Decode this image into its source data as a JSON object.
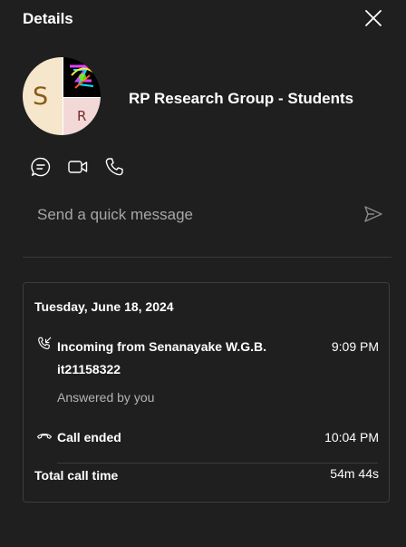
{
  "panel": {
    "title": "Details"
  },
  "group": {
    "name": "RP Research Group - Students",
    "avatar": {
      "left_letter": "S",
      "bottom_right_letter": "R"
    }
  },
  "actions": [
    {
      "icon": "chat-icon"
    },
    {
      "icon": "video-icon"
    },
    {
      "icon": "phone-icon"
    }
  ],
  "quick_message": {
    "placeholder": "Send a quick message",
    "value": ""
  },
  "call_log": {
    "date": "Tuesday, June 18, 2024",
    "incoming": {
      "line1": "Incoming from Senanayake W.G.B.",
      "line2": "it21158322",
      "time": "9:09 PM",
      "status": "Answered by you"
    },
    "ended": {
      "label": "Call ended",
      "time": "10:04 PM"
    },
    "total": {
      "label": "Total call time",
      "value": "54m 44s"
    }
  },
  "colors": {
    "background": "#1f1f1f",
    "avatar_left": "#f6e6cc",
    "avatar_letter": "#8a5a12",
    "avatar_br": "#f2d9d7",
    "avatar_br_letter": "#7a2b2b"
  }
}
